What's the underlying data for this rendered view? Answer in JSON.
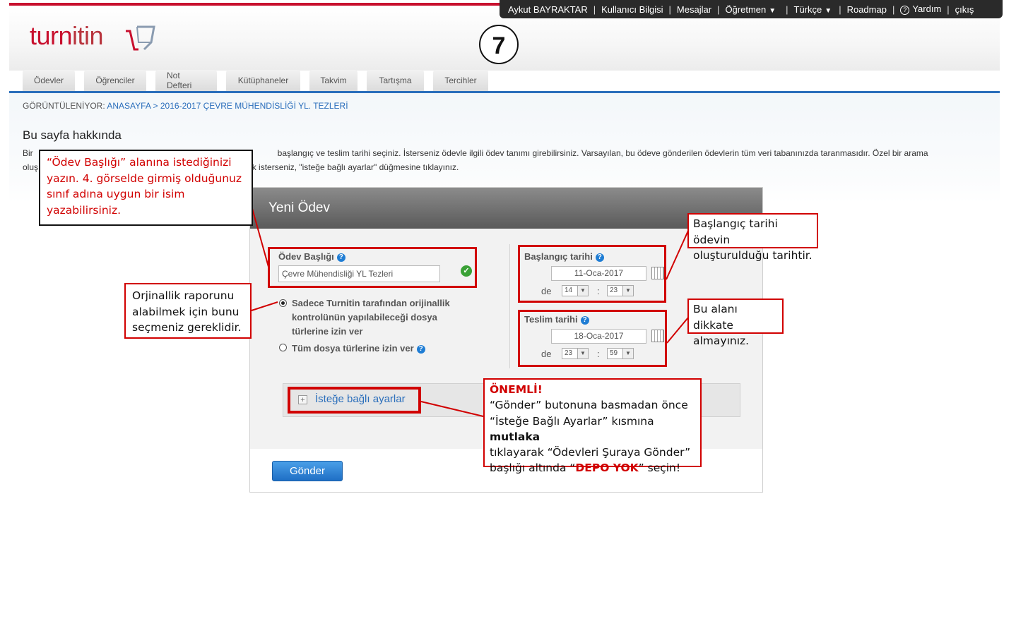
{
  "topbar": {
    "user": "Aykut BAYRAKTAR",
    "user_info": "Kullanıcı Bilgisi",
    "messages": "Mesajlar",
    "role": "Öğretmen",
    "language": "Türkçe",
    "roadmap": "Roadmap",
    "help": "Yardım",
    "logout": "çıkış"
  },
  "logo": {
    "text_a": "turn",
    "text_b": "itin"
  },
  "step_number": "7",
  "tabs": [
    "Ödevler",
    "Öğrenciler",
    "Not Defteri",
    "Kütüphaneler",
    "Takvim",
    "Tartışma",
    "Tercihler"
  ],
  "breadcrumb": {
    "prefix": "GÖRÜNTÜLENİYOR:",
    "home": "ANASAYFA",
    "sep": ">",
    "current": "2016-2017 ÇEVRE MÜHENDİSLİĞİ YL. TEZLERİ"
  },
  "about": {
    "title": "Bu sayfa hakkında",
    "line1_left": "Bir",
    "line1_right": "başlangıç ve teslim tarihi seçiniz. İsterseniz ödevle ilgili ödev tanımı girebilirsiniz. Varsayılan, bu ödeve gönderilen ödevlerin tüm veri tabanınızda taranmasıdır. Özel bir arama",
    "line2_left": "oluş",
    "line2_right": "ek isterseniz, \"isteğe bağlı ayarlar\" düğmesine tıklayınız."
  },
  "form": {
    "panel_title": "Yeni Ödev",
    "title_label": "Ödev Başlığı",
    "title_value": "Çevre Mühendisliği YL Tezleri",
    "radio1_lines": [
      "Sadece Turnitin tarafından orijinallik",
      "kontrolünün yapılabileceği dosya",
      "türlerine izin ver"
    ],
    "radio2_label": "Tüm dosya türlerine izin ver",
    "start_label": "Başlangıç tarihi",
    "start_date": "11-Oca-2017",
    "start_hour": "14",
    "start_minute": "23",
    "due_label": "Teslim tarihi",
    "due_date": "18-Oca-2017",
    "due_hour": "23",
    "due_minute": "59",
    "de_label": "de",
    "colon": ":",
    "optional_label": "İsteğe bağlı ayarlar",
    "submit_label": "Gönder",
    "help_glyph": "?"
  },
  "annotations": {
    "title_note": [
      "“Ödev Başlığı” alanına istediğinizi",
      "yazın. 4. görselde girmiş olduğunuz",
      "sınıf adına uygun bir isim",
      "yazabilirsiniz."
    ],
    "radio_note": [
      "Orjinallik raporunu",
      "alabilmek için bunu",
      "seçmeniz gereklidir."
    ],
    "start_note": [
      "Başlangıç tarihi ödevin",
      "oluşturulduğu tarihtir."
    ],
    "end_note": [
      "Bu alanı dikkate",
      "almayınız."
    ],
    "important": {
      "heading": "ÖNEMLİ!",
      "line1": "“Gönder” butonuna basmadan önce",
      "line2_a": "“İsteğe Bağlı Ayarlar” kısmına ",
      "line2_b": "mutlaka",
      "line3": "tıklayarak “Ödevleri Şuraya Gönder”",
      "line4_a": "başlığı altında “",
      "line4_b": "DEPO YOK",
      "line4_c": "” seçin!"
    }
  },
  "colors": {
    "brand_red": "#c8102e",
    "link_blue": "#2a6ebb",
    "annotation_red": "#d10000",
    "button_blue": "#1f6fc5"
  }
}
